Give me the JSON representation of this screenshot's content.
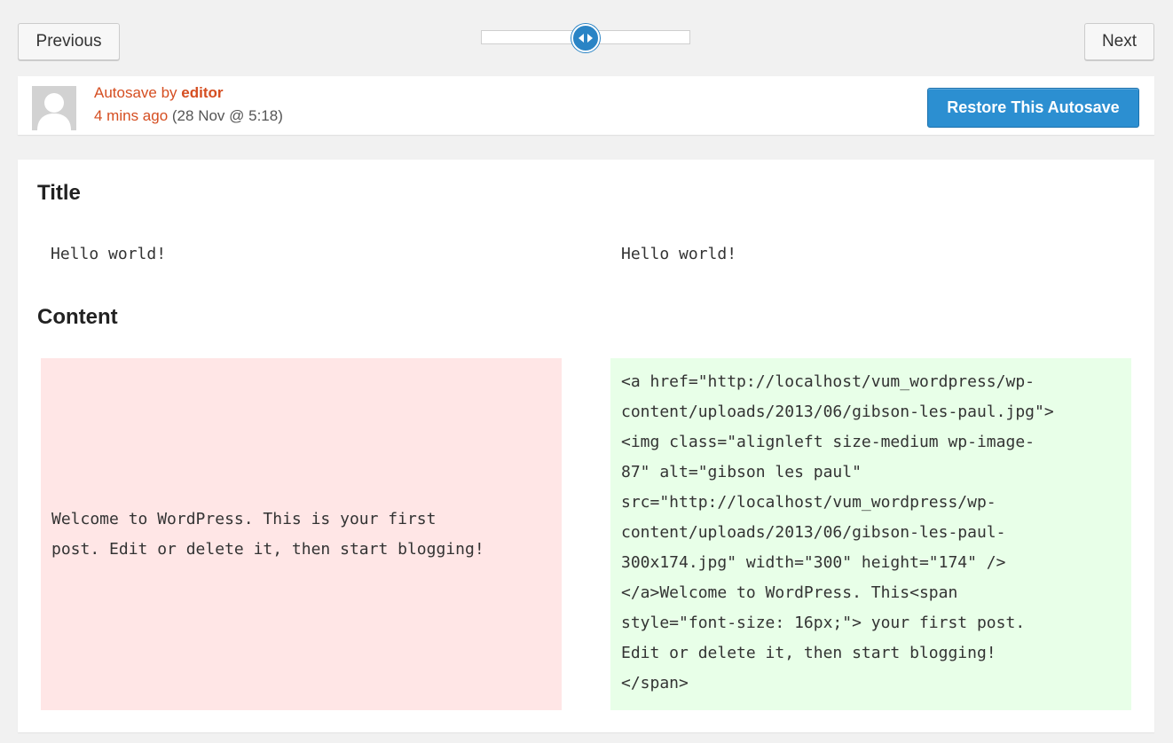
{
  "nav": {
    "previous_label": "Previous",
    "next_label": "Next",
    "slider_position_percent": 50
  },
  "revision": {
    "prefix": "Autosave by ",
    "author": "editor",
    "time_ago": "4 mins ago",
    "timestamp": " (28 Nov @ 5:18)",
    "restore_label": "Restore This Autosave"
  },
  "diff": {
    "title_heading": "Title",
    "title_left": "Hello world!",
    "title_right": "Hello world!",
    "content_heading": "Content",
    "content_left": "Welcome to WordPress. This is your first\npost. Edit or delete it, then start blogging!",
    "content_right": "<a href=\"http://localhost/vum_wordpress/wp-\ncontent/uploads/2013/06/gibson-les-paul.jpg\">\n<img class=\"alignleft size-medium wp-image-\n87\" alt=\"gibson les paul\"\nsrc=\"http://localhost/vum_wordpress/wp-\ncontent/uploads/2013/06/gibson-les-paul-\n300x174.jpg\" width=\"300\" height=\"174\" />\n</a>Welcome to WordPress. This<span\nstyle=\"font-size: 16px;\"> your first post.\nEdit or delete it, then start blogging!\n</span>"
  },
  "colors": {
    "accent": "#2c8fd1",
    "author_link": "#d54e21",
    "removed_bg": "#ffe6e6",
    "added_bg": "#e8ffe8"
  }
}
